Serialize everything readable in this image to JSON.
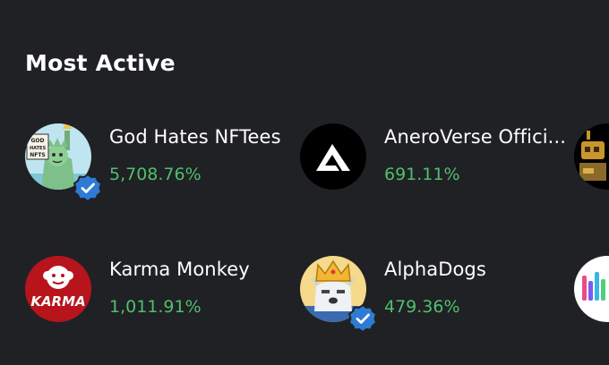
{
  "section": {
    "title": "Most Active"
  },
  "collections": [
    {
      "name": "God Hates NFTees",
      "change": "5,708.76%",
      "verified": true,
      "avatar": "statue-of-liberty-avatar",
      "avatar_text": "GOD HATES NFTS"
    },
    {
      "name": "AneroVerse Offici...",
      "change": "691.11%",
      "verified": false,
      "avatar": "aneroverse-logo-avatar"
    },
    {
      "name": "Karma Monkey",
      "change": "1,011.91%",
      "verified": false,
      "avatar": "karma-monkey-avatar",
      "avatar_text": "KARMA"
    },
    {
      "name": "AlphaDogs",
      "change": "479.36%",
      "verified": true,
      "avatar": "crowned-dog-avatar"
    },
    {
      "name": "",
      "change": "",
      "verified": false,
      "avatar": "robot-avatar"
    },
    {
      "name": "",
      "change": "",
      "verified": false,
      "avatar": "colorful-logo-avatar"
    }
  ],
  "colors": {
    "background": "#202124",
    "positive_change": "#4fbf6e",
    "verified_badge": "#2e7bd6"
  }
}
